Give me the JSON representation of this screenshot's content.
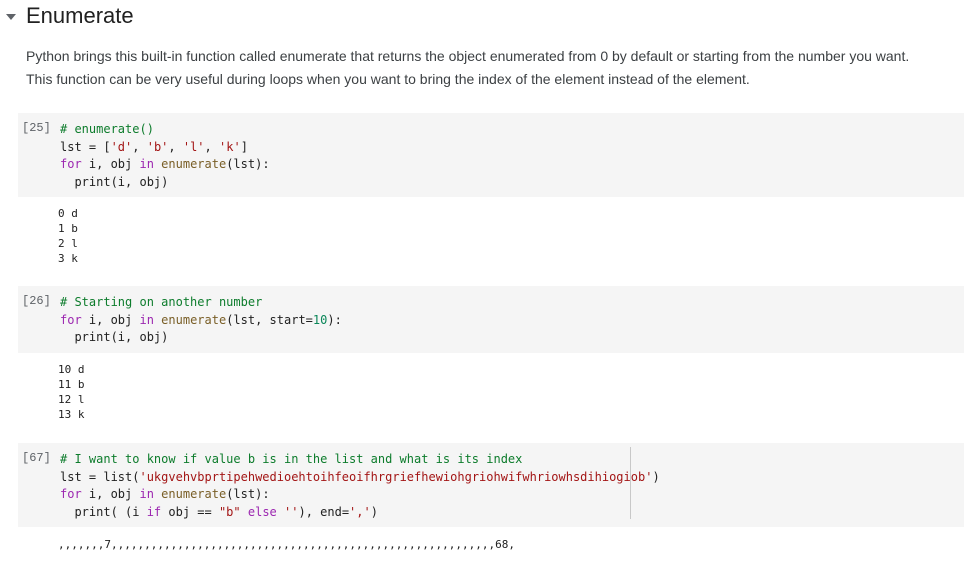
{
  "section": {
    "title": "Enumerate",
    "toggle_icon": "caret-down-icon"
  },
  "intro": "Python brings this built-in function called enumerate that returns the object enumerated from 0 by default or starting from the number you want. This function can be very useful during loops when you want to bring the index of the element instead of the element.",
  "cells": [
    {
      "prompt": "[25]",
      "code": [
        [
          {
            "t": "# enumerate()",
            "c": "cmt"
          }
        ],
        [
          {
            "t": "lst = [",
            "c": ""
          },
          {
            "t": "'d'",
            "c": "str"
          },
          {
            "t": ", ",
            "c": ""
          },
          {
            "t": "'b'",
            "c": "str"
          },
          {
            "t": ", ",
            "c": ""
          },
          {
            "t": "'l'",
            "c": "str"
          },
          {
            "t": ", ",
            "c": ""
          },
          {
            "t": "'k'",
            "c": "str"
          },
          {
            "t": "]",
            "c": ""
          }
        ],
        [
          {
            "t": "for",
            "c": "kw"
          },
          {
            "t": " i, obj ",
            "c": ""
          },
          {
            "t": "in",
            "c": "kw"
          },
          {
            "t": " ",
            "c": ""
          },
          {
            "t": "enumerate",
            "c": "fn"
          },
          {
            "t": "(lst):",
            "c": ""
          }
        ],
        [
          {
            "t": "  print(i, obj)",
            "c": ""
          }
        ]
      ],
      "output": [
        "0 d",
        "1 b",
        "2 l",
        "3 k"
      ]
    },
    {
      "prompt": "[26]",
      "code": [
        [
          {
            "t": "# Starting on another number",
            "c": "cmt"
          }
        ],
        [
          {
            "t": "for",
            "c": "kw"
          },
          {
            "t": " i, obj ",
            "c": ""
          },
          {
            "t": "in",
            "c": "kw"
          },
          {
            "t": " ",
            "c": ""
          },
          {
            "t": "enumerate",
            "c": "fn"
          },
          {
            "t": "(lst, start=",
            "c": ""
          },
          {
            "t": "10",
            "c": "num"
          },
          {
            "t": "):",
            "c": ""
          }
        ],
        [
          {
            "t": "  print(i, obj)",
            "c": ""
          }
        ]
      ],
      "output": [
        "10 d",
        "11 b",
        "12 l",
        "13 k"
      ]
    },
    {
      "prompt": "[67]",
      "code": [
        [
          {
            "t": "# I want to know if value b is in the list and what is its index",
            "c": "cmt"
          }
        ],
        [
          {
            "t": "lst = list(",
            "c": ""
          },
          {
            "t": "'ukgvehvbprtipehwedioehtoihfeoifhrgriefhewiohgriohwifwhriowhsdihiogiob'",
            "c": "str"
          },
          {
            "t": ")",
            "c": ""
          }
        ],
        [
          {
            "t": "for",
            "c": "kw"
          },
          {
            "t": " i, obj ",
            "c": ""
          },
          {
            "t": "in",
            "c": "kw"
          },
          {
            "t": " ",
            "c": ""
          },
          {
            "t": "enumerate",
            "c": "fn"
          },
          {
            "t": "(lst):",
            "c": ""
          }
        ],
        [
          {
            "t": "  print( (i ",
            "c": ""
          },
          {
            "t": "if",
            "c": "kw"
          },
          {
            "t": " obj == ",
            "c": ""
          },
          {
            "t": "\"b\"",
            "c": "str"
          },
          {
            "t": " ",
            "c": ""
          },
          {
            "t": "else",
            "c": "kw"
          },
          {
            "t": " ",
            "c": ""
          },
          {
            "t": "''",
            "c": "str"
          },
          {
            "t": "), end=",
            "c": ""
          },
          {
            "t": "','",
            "c": "str"
          },
          {
            "t": ")",
            "c": ""
          }
        ]
      ],
      "output": [
        ",,,,,,,7,,,,,,,,,,,,,,,,,,,,,,,,,,,,,,,,,,,,,,,,,,,,,,,,,,,,,,,,,,68,"
      ]
    }
  ]
}
